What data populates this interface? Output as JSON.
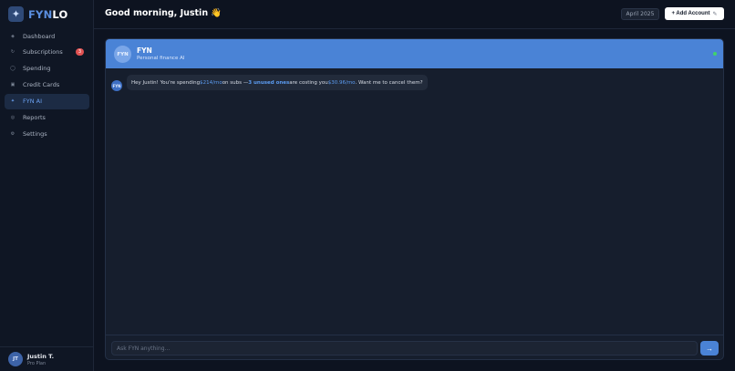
{
  "brand": {
    "mark": "✦",
    "name_a": "FYN",
    "name_b": "LO"
  },
  "sidebar": {
    "items": [
      {
        "label": "Dashboard",
        "icon": "◈"
      },
      {
        "label": "Subscriptions",
        "icon": "↻",
        "badge": "3"
      },
      {
        "label": "Spending",
        "icon": "◯"
      },
      {
        "label": "Credit Cards",
        "icon": "▣"
      },
      {
        "label": "FYN AI",
        "icon": "✦",
        "active": true
      },
      {
        "label": "Reports",
        "icon": "◎"
      },
      {
        "label": "Settings",
        "icon": "⚙"
      }
    ]
  },
  "user": {
    "initials": "JT",
    "name": "Justin T.",
    "plan": "Pro Plan"
  },
  "header": {
    "greeting": "Good morning, Justin 👋",
    "period": "April 2025",
    "add_label": "+ Add Account",
    "add_icon": "✎"
  },
  "chat": {
    "bot_initials": "FYN",
    "bot_name": "FYN",
    "bot_subtitle": "Personal finance AI",
    "message": {
      "avatar": "FYN",
      "p1": "Hey Justin! You're spending ",
      "amt1": "$214/mo",
      "p2": " on subs — ",
      "hl": "3 unused ones",
      "p3": " are costing you ",
      "amt2": "$30.96/mo",
      "p4": ". Want me to cancel them?"
    },
    "input_placeholder": "Ask FYN anything...",
    "send_icon": "→"
  },
  "colors": {
    "accent": "#4a83d6",
    "background": "#0d1320",
    "panel": "#161e2d",
    "badge": "#e05252",
    "online": "#41d36b"
  }
}
